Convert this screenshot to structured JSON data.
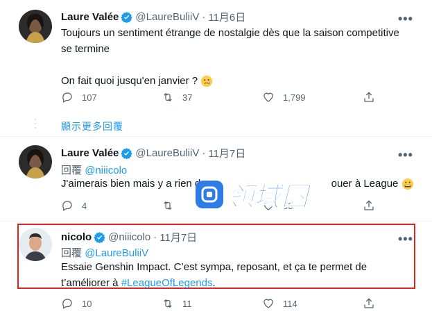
{
  "tweets": [
    {
      "name": "Laure Valée",
      "handle": "@LaureBuliiV",
      "dot": "·",
      "time": "11月6日",
      "lines": [
        "Toujours un sentiment étrange de nostalgie dès que la saison competitive",
        "se termine",
        "On fait quoi jusqu'en janvier ?"
      ],
      "emoji": "sad-tear-face",
      "replies": "107",
      "retweets": "37",
      "likes": "1,799"
    },
    {
      "name": "Laure Valée",
      "handle": "@LaureBuliiV",
      "dot": "·",
      "time": "11月7日",
      "replying_prefix": "回覆",
      "replying_to": "@niiicolo",
      "text_before": "J'aimerais bien mais y a rien de ",
      "text_after": "ouer à League",
      "emoji": "grinning-face",
      "replies": "4",
      "retweets": "",
      "likes": "58"
    },
    {
      "name": "nicolo",
      "handle": "@niiicolo",
      "dot": "·",
      "time": "11月7日",
      "replying_prefix": "回覆",
      "replying_to": "@LaureBuliiV",
      "line1": "Essaie Genshin Impact. C’est sympa, reposant, et ça te permet de",
      "line2_prefix": "t’améliorer à ",
      "hashtag": "#LeagueOfLegends",
      "line2_suffix": ".",
      "replies": "10",
      "retweets": "11",
      "likes": "114"
    }
  ],
  "show_more": "顯示更多回覆",
  "watermark": "领域圈",
  "more_glyph": "•••",
  "colors": {
    "accent": "#1d9bf0",
    "muted": "#536471",
    "highlight_border": "#e0231e",
    "watermark": "#2d7de5"
  }
}
